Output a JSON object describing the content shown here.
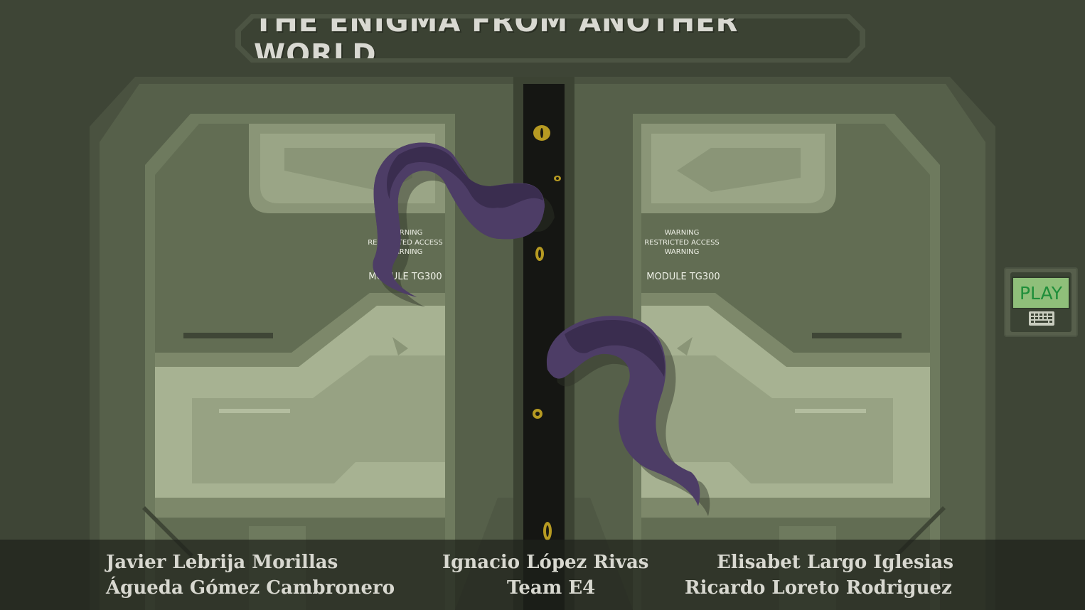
{
  "game_title": "THE ENIGMA FROM ANOTHER WORLD",
  "doors": {
    "left": {
      "warning_line1": "WARNING",
      "warning_line2": "RESTRICTED ACCESS",
      "warning_line3": "WARNING",
      "module": "MODULE TG300"
    },
    "right": {
      "warning_line1": "WARNING",
      "warning_line2": "RESTRICTED ACCESS",
      "warning_line3": "WARNING",
      "module": "MODULE TG300"
    }
  },
  "play_button": {
    "label": "PLAY",
    "icon": "keyboard-icon"
  },
  "credits": {
    "col1_line1": "Javier Lebrija Morillas",
    "col1_line2": "Águeda Gómez Cambronero",
    "col2_line1": "Ignacio López Rivas",
    "col2_line2": "Team E4",
    "col3_line1": "Elisabet Largo Iglesias",
    "col3_line2": "Ricardo Loreto Rodriguez"
  },
  "colors": {
    "background": "#3e4536",
    "door_outer": "#56604a",
    "door_panel": "#8a9577",
    "door_highlight": "#a7b292",
    "gap": "#151613",
    "tentacle": "#4d3d66",
    "tentacle_dark": "#3a2d4f",
    "eye": "#b69a22",
    "play_text": "#1f8e3a",
    "play_screen": "#8fbf7a"
  }
}
